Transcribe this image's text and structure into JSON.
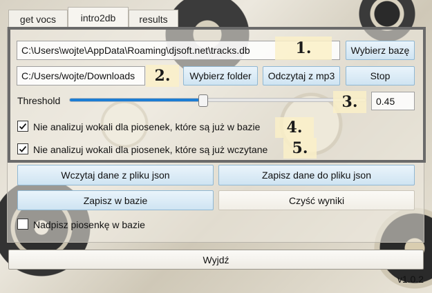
{
  "tabs": [
    "get vocs",
    "intro2db",
    "results"
  ],
  "db": {
    "path": "C:\\Users\\wojte\\AppData\\Roaming\\djsoft.net\\tracks.db",
    "select_label": "Wybierz bazę"
  },
  "folder": {
    "path": "C:/Users/wojte/Downloads",
    "select_label": "Wybierz folder",
    "read_label": "Odczytaj z mp3",
    "stop_label": "Stop"
  },
  "threshold": {
    "label": "Threshold",
    "value": "0.45",
    "slider_fraction": 0.45
  },
  "checks": [
    {
      "label": "Nie analizuj wokali dla piosenek, które są już w bazie",
      "checked": true
    },
    {
      "label": "Nie analizuj wokali dla piosenek, które są już wczytane",
      "checked": true
    }
  ],
  "markers": [
    "1.",
    "2.",
    "3.",
    "4.",
    "5."
  ],
  "actions": {
    "load_json": "Wczytaj dane z pliku json",
    "save_json": "Zapisz dane do pliku json",
    "save_db": "Zapisz w bazie",
    "clear": "Czyść wyniki",
    "overwrite_label": "Nadpisz piosenkę w bazie",
    "overwrite_checked": false
  },
  "exit_label": "Wyjdź",
  "version": "v1.0.2",
  "colors": {
    "accent": "#1c7dd4",
    "outline": "#6a6a6a",
    "button_blue": "#cfe4f2"
  }
}
